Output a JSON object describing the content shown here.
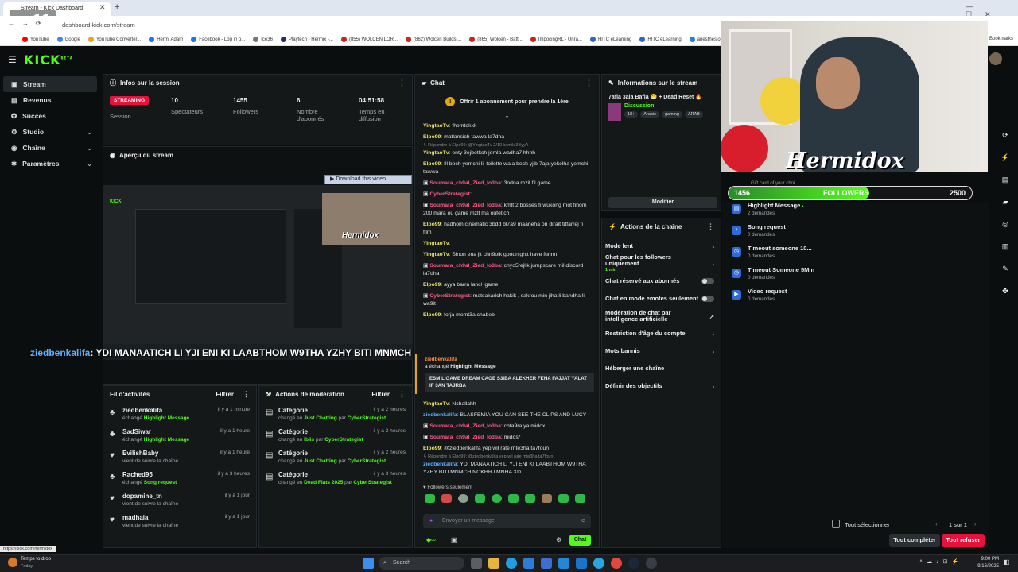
{
  "browser": {
    "tab_title": "Stream - Kick Dashboard",
    "tab_overlay_number": "11",
    "url": "dashboard.kick.com/stream",
    "bookmarks": [
      "YouTube",
      "Google",
      "YouTube Converter...",
      "Hermi Adam",
      "Facebook - Log in o...",
      "Ice36",
      "Playtech - Hermix -...",
      "(855) WOLCEN LOR...",
      "(862) Wolcen Builds:...",
      "(865) Wolcen - Batt...",
      "ImpocingRL - Unra...",
      "HITC eLearning",
      "HITC eLearning",
      "anesthesiology"
    ],
    "bookmarks_right": "Bookmarks"
  },
  "app": {
    "logo": "KICK",
    "logo_sup": "BETA"
  },
  "sidebar": {
    "items": [
      {
        "label": "Stream",
        "icon": "video-icon"
      },
      {
        "label": "Revenus",
        "icon": "money-icon"
      },
      {
        "label": "Succès",
        "icon": "trophy-icon"
      },
      {
        "label": "Studio",
        "icon": "studio-icon"
      },
      {
        "label": "Chaîne",
        "icon": "channel-icon"
      },
      {
        "label": "Paramètres",
        "icon": "gear-icon"
      }
    ],
    "footer_link": "https://kick.com/hermidox"
  },
  "session": {
    "title": "Infos sur la session",
    "badge": "STREAMING",
    "badge_label": "Session",
    "stats": [
      {
        "value": "10",
        "label": "Spectateurs"
      },
      {
        "value": "1455",
        "label": "Followers"
      },
      {
        "value": "6",
        "label": "Nombre d'abonnés"
      },
      {
        "value": "04:51:58",
        "label": "Temps en diffusion"
      }
    ]
  },
  "preview": {
    "title": "Aperçu du stream",
    "download_label": "Download this video",
    "stream_name": "Hermidox"
  },
  "overlay_message": {
    "user": "ziedbenkalifa",
    "text": ": YDI MANAATICH LI YJI ENI KI LAABTHOM W9THA YZHY BITI MNMCH NOKHRJ MNHA XD"
  },
  "activity": {
    "title": "Fil d'activités",
    "filter": "Filtrer",
    "rows": [
      {
        "user": "ziedbenkalifa",
        "prefix": "échangé",
        "item": "Highlight Message",
        "time": "il y a 1 minute"
      },
      {
        "user": "SadSiwar",
        "prefix": "échangé",
        "item": "Highlight Message",
        "time": "il y a 1 heure"
      },
      {
        "user": "EvilishBaby",
        "prefix": "vient de suivre la chaîne",
        "item": "",
        "time": "il y a 1 heure"
      },
      {
        "user": "Rached95",
        "prefix": "échangé",
        "item": "Song request",
        "time": "il y a 3 heures"
      },
      {
        "user": "dopamine_tn",
        "prefix": "vient de suivre la chaîne",
        "item": "",
        "time": "il y a 1 jour"
      },
      {
        "user": "madhaia",
        "prefix": "vient de suivre la chaîne",
        "item": "",
        "time": "il y a 1 jour"
      }
    ]
  },
  "moderation": {
    "title": "Actions de modération",
    "filter": "Filtrer",
    "rows": [
      {
        "label": "Catégorie",
        "prefix": "changé en",
        "cat": "Just Chatting",
        "by": "par",
        "mod": "CyberStrategist",
        "time": "il y a 2 heures"
      },
      {
        "label": "Catégorie",
        "prefix": "changé en",
        "cat": "Iblis",
        "by": "par",
        "mod": "CyberStrategist",
        "time": "il y a 2 heures"
      },
      {
        "label": "Catégorie",
        "prefix": "changé en",
        "cat": "Just Chatting",
        "by": "par",
        "mod": "CyberStrategist",
        "time": "il y a 2 heures"
      },
      {
        "label": "Catégorie",
        "prefix": "changé en",
        "cat": "Dead Flats 2025",
        "by": "par",
        "mod": "CyberStrategist",
        "time": "il y a 3 heures"
      }
    ]
  },
  "chat": {
    "title": "Chat",
    "offer": "Offrir 1 abonnement pour prendre la 1ère",
    "messages": [
      {
        "user": "YingtaoTv",
        "color": "y",
        "text": ": fhemtekkk"
      },
      {
        "user": "Elpo99",
        "color": "y",
        "text": ": matlansich tawwa la7dha"
      },
      {
        "reply": "Répondre à Elpo99: @YingtaoTv 2/10 kemik 3ByyA"
      },
      {
        "user": "YingtaoTv",
        "color": "y",
        "text": ": enty 3ejbetkch jemla wadha7 hhhh"
      },
      {
        "user": "Elpo99",
        "color": "y",
        "text": ": Ill bech yemchi lil toilette wala bech yjib 7aja yekelha yemchi tawwa"
      },
      {
        "user": "Soumara_ch9al_Zied_lo3ba",
        "color": "pk",
        "text": ": 3odna mzit fil game"
      },
      {
        "user": "CyberStrategist",
        "color": "pk",
        "text": ":"
      },
      {
        "user": "Soumara_ch9al_Zied_lo3ba",
        "color": "pk",
        "text": ": kmlt 2 bosses fi wukong mot fihom 200 mara ou game mzlt ma oufetich"
      },
      {
        "user": "Elpo99",
        "color": "y",
        "text": ": hadhom cinematic 3bdd bl7a9 maaneha on dirait titfarrej fi film"
      },
      {
        "user": "YingtaoTv",
        "color": "y",
        "text": ":"
      },
      {
        "user": "YingtaoTv",
        "color": "y",
        "text": ": Sinon ena jit chn9olk goodnightt have funnn"
      },
      {
        "user": "Soumara_ch9al_Zied_lo3ba",
        "color": "pk",
        "text": ": chyo5rejlik jumpscare mil discord la7dha"
      },
      {
        "user": "Elpo99",
        "color": "y",
        "text": ": ayya barra lancl lgame"
      },
      {
        "user": "CyberStrategist",
        "color": "pk",
        "text": ": matsakarich hakik , sakrou min jiha li bahdha li wa9it"
      },
      {
        "user": "Elpo99",
        "color": "y",
        "text": ": forja momt3a chabeb"
      }
    ],
    "highlight": {
      "user": "ziedbenkalifa",
      "action": "a échangé",
      "item": "Highlight Message",
      "text": "ESM L GAME DREAM CAGE S3IBA ALEKHER FEHA FAJJAT YALAT IF 3AN TAJRBA"
    },
    "messages2": [
      {
        "user": "YingtaoTv",
        "color": "y",
        "text": ": Nchallahh"
      },
      {
        "user": "ziedbenkalifa",
        "color": "bl",
        "text": ": BLASFEMIA YOU CAN SEE THE CLIPS AND LUCY"
      },
      {
        "user": "Soumara_ch9al_Zied_lo3ba",
        "color": "pk",
        "text": ": chta9ra ya midox"
      },
      {
        "user": "Soumara_ch9al_Zied_lo3ba",
        "color": "pk",
        "text": ": midos*"
      },
      {
        "user": "Elpo99",
        "color": "y",
        "text": ": @ziedbenkalifa yep wil rate mte3ha ta7foun"
      },
      {
        "reply": "Répondre à Elpo99: @ziedbenkalifa yep wil rate mte3ha ta7foun"
      },
      {
        "user": "ziedbenkalifa",
        "color": "bl",
        "text": ": YDI MANAATICH LI YJI ENI KI LAABTHOM W9THA YZHY BITI MNMCH NOKHRJ MNHA XD"
      }
    ],
    "mode": "Followers seulement",
    "input_placeholder": "Envoyer un message",
    "send": "Chat"
  },
  "stream_info": {
    "title": "Informations sur le stream",
    "stream_title": "7afla 3ala Bafla 😁 + Dead Reset 🔥",
    "category": "Discussion",
    "tags": [
      "18+",
      "Arabic",
      "gaming",
      "ARAB"
    ],
    "modify": "Modifier"
  },
  "channel_actions": {
    "title": "Actions de la chaîne",
    "items": [
      {
        "label": "Mode lent",
        "type": "chev"
      },
      {
        "label": "Chat pour les followers uniquement",
        "sub": "1 min",
        "type": "chev"
      },
      {
        "label": "Chat réservé aux abonnés",
        "type": "toggle"
      },
      {
        "label": "Chat en mode emotes seulement",
        "type": "toggle"
      },
      {
        "label": "Modération de chat par intelligence artificielle",
        "type": "ext"
      },
      {
        "label": "Restriction d'âge du compte",
        "type": "chev"
      },
      {
        "label": "Mots bannis",
        "type": "chev"
      },
      {
        "label": "Héberger une chaîne",
        "type": "none"
      },
      {
        "label": "Définir des objectifs",
        "type": "chev"
      }
    ]
  },
  "webcam": {
    "streamer_name": "Hermidox",
    "followers_left": "1456",
    "followers_label": "FOLLOWERS",
    "followers_right": "2500",
    "followers_progress": 0.58,
    "goal_text": "Gift card of your choi"
  },
  "redemptions": {
    "items": [
      {
        "title": "Highlight Message",
        "sub": "2 demandes"
      },
      {
        "title": "Song request",
        "sub": "0 demandes"
      },
      {
        "title": "Timeout someone 10...",
        "sub": "0 demandes"
      },
      {
        "title": "Timeout Someone 5Min",
        "sub": "0 demandes"
      },
      {
        "title": "Video request",
        "sub": "0 demandes"
      }
    ],
    "select_all": "Tout sélectionner",
    "page": "1 sur 1",
    "complete_all": "Tout compléter",
    "reject_all": "Tout refuser"
  },
  "taskbar": {
    "weather_title": "Temps to drop",
    "weather_sub": "Friday",
    "search": "Search",
    "time": "9:00 PM",
    "date": "9/16/2025"
  }
}
